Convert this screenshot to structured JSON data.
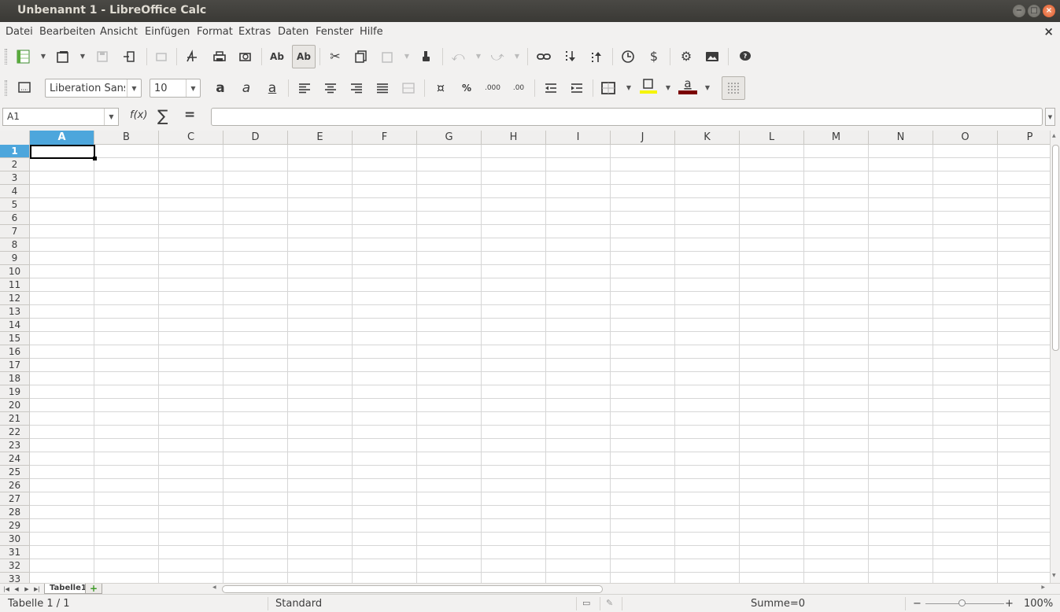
{
  "window": {
    "title": "Unbenannt 1 - LibreOffice Calc",
    "btn_min": "−",
    "btn_max": "□",
    "btn_close": "×"
  },
  "menu": {
    "items": [
      "Datei",
      "Bearbeiten",
      "Ansicht",
      "Einfügen",
      "Format",
      "Extras",
      "Daten",
      "Fenster",
      "Hilfe"
    ],
    "close": "×"
  },
  "toolbar2": {
    "font_name": "Liberation Sans",
    "font_size": "10",
    "bold_glyph": "a",
    "italic_glyph": "a",
    "underline_glyph": "a",
    "percent": "%",
    "highlight_color": "#f5f500",
    "font_color": "#7a0000"
  },
  "formula_bar": {
    "name_box": "A1",
    "fx": "f(x)",
    "sum": "∑",
    "equals": "=",
    "content": ""
  },
  "grid": {
    "columns": [
      "A",
      "B",
      "C",
      "D",
      "E",
      "F",
      "G",
      "H",
      "I",
      "J",
      "K",
      "L",
      "M",
      "N",
      "O",
      "P"
    ],
    "rows": [
      "1",
      "2",
      "3",
      "4",
      "5",
      "6",
      "7",
      "8",
      "9",
      "10",
      "11",
      "12",
      "13",
      "14",
      "15",
      "16",
      "17",
      "18",
      "19",
      "20",
      "21",
      "22",
      "23",
      "24",
      "25",
      "26",
      "27",
      "28",
      "29",
      "30",
      "31",
      "32",
      "33"
    ],
    "selected_column": "A",
    "selected_row": "1",
    "accent_color": "#4da6dc"
  },
  "sheets": {
    "tabs": [
      "Tabelle1"
    ],
    "add": "+"
  },
  "status": {
    "sheet": "Tabelle 1 / 1",
    "page_style": "Standard",
    "sum": "Summe=0",
    "zoom_minus": "−",
    "zoom_plus": "+",
    "zoom": "100%",
    "zoom_level": 100
  }
}
